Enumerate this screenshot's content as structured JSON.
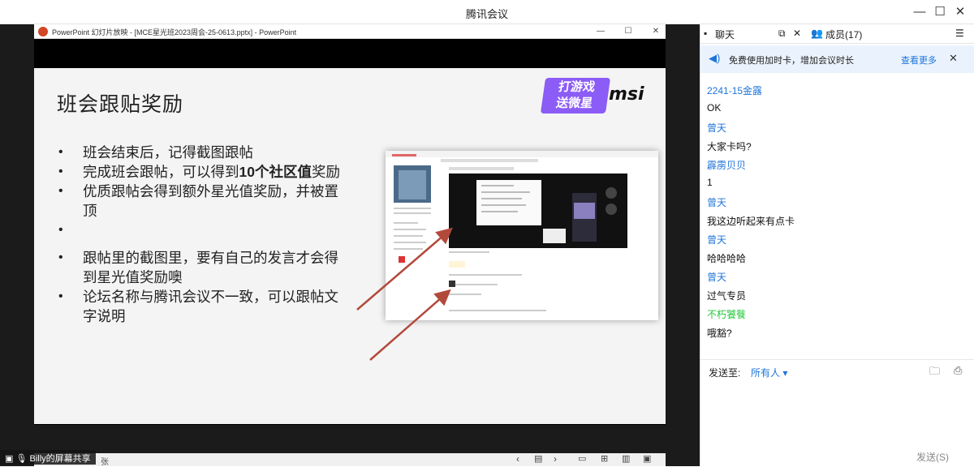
{
  "window": {
    "title": "腾讯会议",
    "controls": [
      "—",
      "☐",
      "✕"
    ]
  },
  "ppt": {
    "window_title": "PowerPoint 幻灯片放映 - [MCE星光班2023周会-25-0613.pptx] - PowerPoint"
  },
  "slide": {
    "title": "班会跟贴奖励",
    "bullets": [
      {
        "text": "班会结束后，记得截图跟帖"
      },
      {
        "pre": "完成班会跟帖，可以得到",
        "bold": "10个社区值",
        "post": "奖励"
      },
      {
        "text": "优质跟帖会得到额外星光值奖励，并被置顶"
      },
      {
        "text": "跟帖里的截图里，要有自己的发言才会得到星光值奖励噢"
      },
      {
        "text": "论坛名称与腾讯会议不一致，可以跟帖文字说明"
      }
    ],
    "promo_line1": "打游戏",
    "promo_line2": "送微星",
    "brand": "msi"
  },
  "share": {
    "label": "Billy的屏幕共享",
    "status_text": "张"
  },
  "panel": {
    "tab_chat": "聊天",
    "tab_members": "成员(17)",
    "banner_text": "免费使用加时卡，增加会议时长",
    "banner_link": "查看更多",
    "messages": [
      {
        "type": "name",
        "text": "2241-15金露"
      },
      {
        "type": "text",
        "text": "OK"
      },
      {
        "type": "name",
        "text": "曾天"
      },
      {
        "type": "text",
        "text": "大家卡吗?"
      },
      {
        "type": "name",
        "text": "霹雳贝贝"
      },
      {
        "type": "text",
        "text": "1"
      },
      {
        "type": "name",
        "text": "曾天"
      },
      {
        "type": "text",
        "text": "我这边听起来有点卡"
      },
      {
        "type": "name",
        "text": "曾天"
      },
      {
        "type": "text",
        "text": "哈哈哈哈"
      },
      {
        "type": "name",
        "text": "曾天"
      },
      {
        "type": "text",
        "text": "过气专员"
      },
      {
        "type": "name-green",
        "text": "不朽饕餮"
      },
      {
        "type": "text",
        "text": "哦豁?"
      }
    ],
    "send_to_label": "发送至:",
    "send_to_value": "所有人 ▾",
    "send_button": "发送(S)"
  },
  "colors": {
    "accent": "#1e74d9",
    "green_name": "#27c93f",
    "promo": "#8b5cf6",
    "arrow": "#b24a3b"
  }
}
